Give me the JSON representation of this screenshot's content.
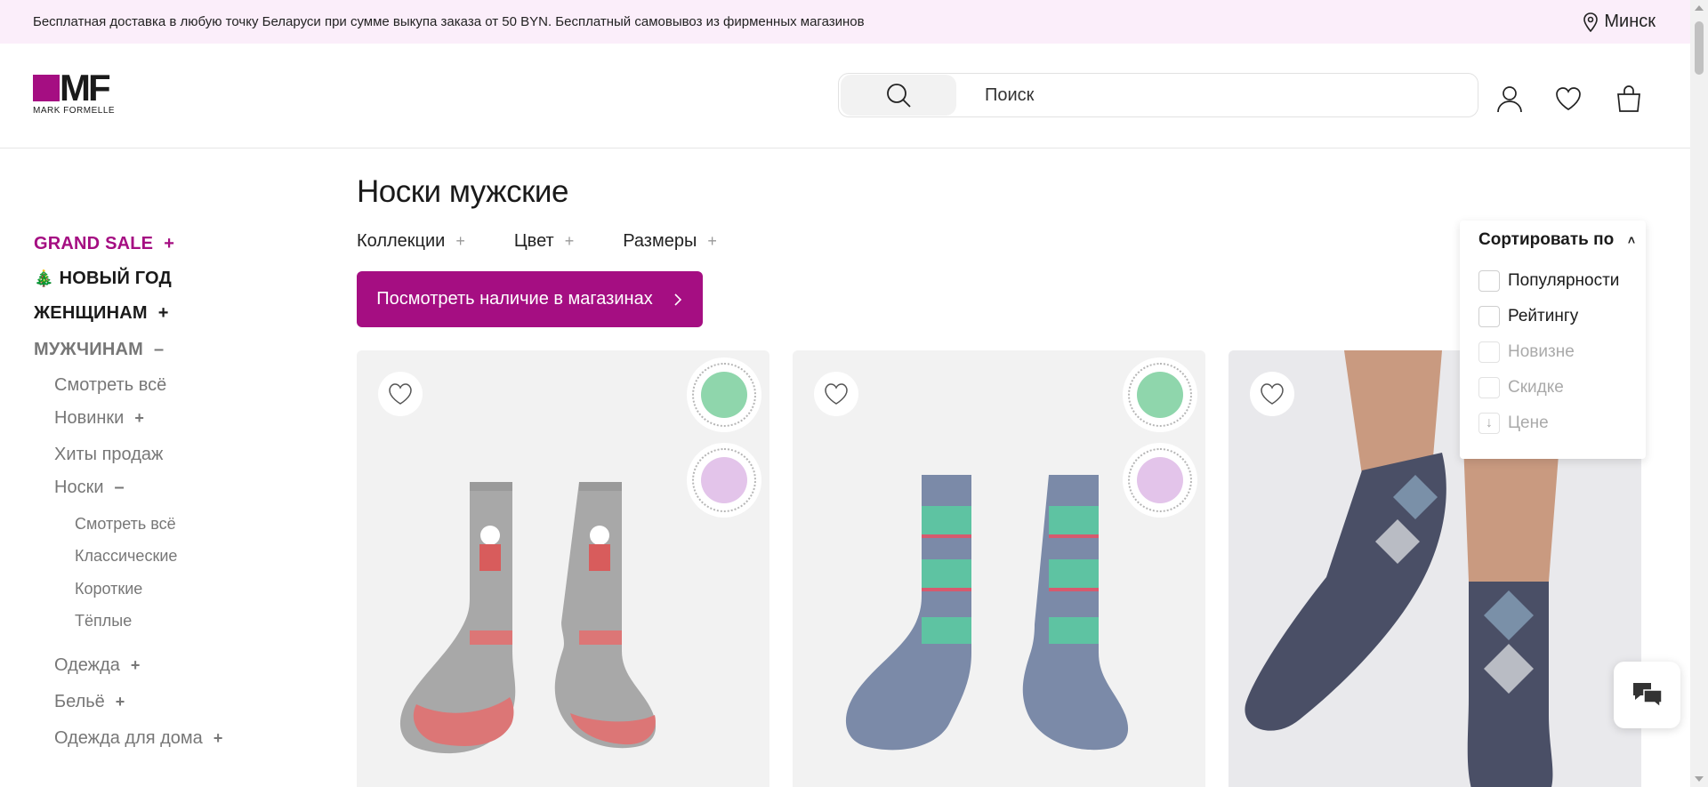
{
  "topbar": {
    "delivery_text": "Бесплатная доставка в любую точку Беларуси при сумме выкупа заказа от 50 BYN. Бесплатный самовывоз из фирменных магазинов",
    "city": "Минск"
  },
  "header": {
    "logo_mark": "MF",
    "logo_text": "MARK FORMELLE",
    "search_placeholder": "Поиск",
    "icons": [
      "search-icon",
      "user-icon",
      "heart-icon",
      "bag-icon"
    ]
  },
  "sidebar": {
    "grand_sale": "GRAND SALE",
    "new_year": "НОВЫЙ ГОД",
    "new_year_icon": "🎄",
    "women": "ЖЕНЩИНАМ",
    "men": "МУЖЧИНАМ",
    "men_items": {
      "view_all": "Смотреть всё",
      "new": "Новинки",
      "hits": "Хиты продаж",
      "socks": "Носки",
      "clothes": "Одежда",
      "underwear": "Бельё",
      "homewear": "Одежда для дома"
    },
    "socks_items": {
      "view_all": "Смотреть всё",
      "classic": "Классические",
      "short": "Короткие",
      "warm": "Тёплые"
    },
    "accent_color": "#a50e82"
  },
  "main": {
    "title": "Носки мужские",
    "filters": {
      "collections": "Коллекции",
      "color": "Цвет",
      "sizes": "Размеры"
    },
    "store_button": "Посмотреть наличие в магазинах"
  },
  "sort": {
    "label": "Сортировать по",
    "options": {
      "popularity": "Популярности",
      "rating": "Рейтингу",
      "novelty": "Новизне",
      "discount": "Скидке",
      "price": "Цене"
    }
  },
  "products": [
    {
      "badges": [
        "new-year-collection-badge",
        "terry-foot-badge"
      ]
    },
    {
      "badges": [
        "new-year-collection-badge",
        "terry-socks-badge"
      ]
    },
    {
      "badges": []
    }
  ]
}
